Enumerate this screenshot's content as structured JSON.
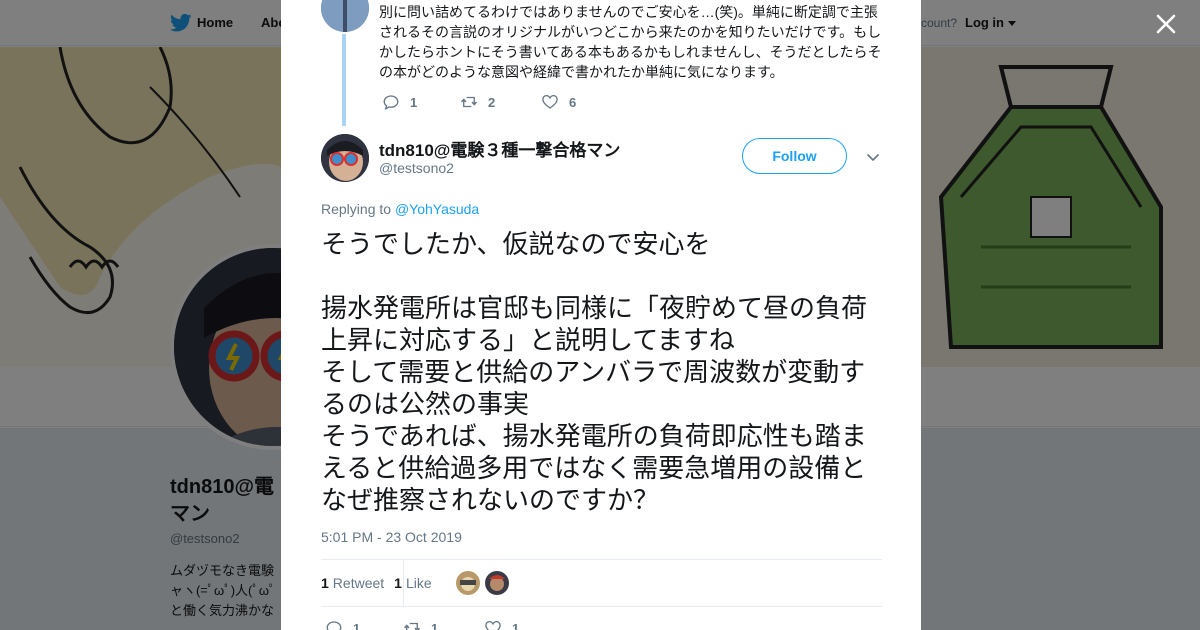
{
  "nav": {
    "home_label": "Home",
    "about_label": "Abo",
    "account_text": "ccount?",
    "login_label": "Log in"
  },
  "profile": {
    "name": "tdn810@電\nマン",
    "handle": "@testsono2",
    "bio": "ムダヅモなき電験\nャヽ(=ﾟωﾟ)人(ﾟωﾟ\nと働く気力沸かな"
  },
  "previous_tweet": {
    "text": "別に問い詰めてるわけではありませんのでご安心を…(笑)。単純に断定調で主張されるその言説のオリジナルがいつどこから来たのかを知りたいだけです。もしかしたらホントにそう書いてある本もあるかもしれませんし、そうだとしたらその本がどのような意図や経緯で書かれたか単純に気になります。",
    "reply_count": "1",
    "retweet_count": "2",
    "like_count": "6"
  },
  "tweet": {
    "author_name": "tdn810@電験３種一撃合格マン",
    "author_handle": "@testsono2",
    "follow_label": "Follow",
    "replying_prefix": "Replying to ",
    "replying_to": "@YohYasuda",
    "text": "そうでしたか、仮説なので安心を\n\n揚水発電所は官邸も同様に「夜貯めて昼の負荷上昇に対応する」と説明してますね\nそして需要と供給のアンバラで周波数が変動するのは公然の事実\nそうであれば、揚水発電所の負荷即応性も踏まえると供給過多用ではなく需要急増用の設備となぜ推察されないのですか？",
    "timestamp": "5:01 PM - 23 Oct 2019",
    "retweets_count": "1",
    "retweets_label": "Retweet",
    "likes_count": "1",
    "likes_label": "Like",
    "reply_count": "1",
    "retweet_count": "1",
    "like_count": "1"
  },
  "colors": {
    "twitter_blue": "#1da1f2",
    "text_primary": "#14171a",
    "text_secondary": "#657786",
    "thread_line": "#a8d4f5"
  },
  "icons": [
    "twitter-bird-icon",
    "close-icon",
    "reply-icon",
    "retweet-icon",
    "heart-icon",
    "chevron-down-icon"
  ]
}
